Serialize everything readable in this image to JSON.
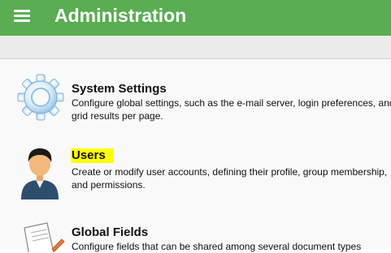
{
  "header": {
    "title": "Administration",
    "menu_icon": "hamburger-menu-icon",
    "background_color": "#5aad52"
  },
  "items": [
    {
      "title": "System Settings",
      "description": "Configure global settings, such as the e-mail server, login preferences, and grid results per page.",
      "icon": "gear-icon",
      "highlighted": false
    },
    {
      "title": "Users",
      "description": "Create or modify user accounts, defining their profile, group membership, and permissions.",
      "icon": "user-icon",
      "highlighted": true,
      "highlight_color": "#ffff00"
    },
    {
      "title": "Global Fields",
      "description": "Configure fields that can be shared among several document types",
      "icon": "document-pen-icon",
      "highlighted": false
    }
  ]
}
